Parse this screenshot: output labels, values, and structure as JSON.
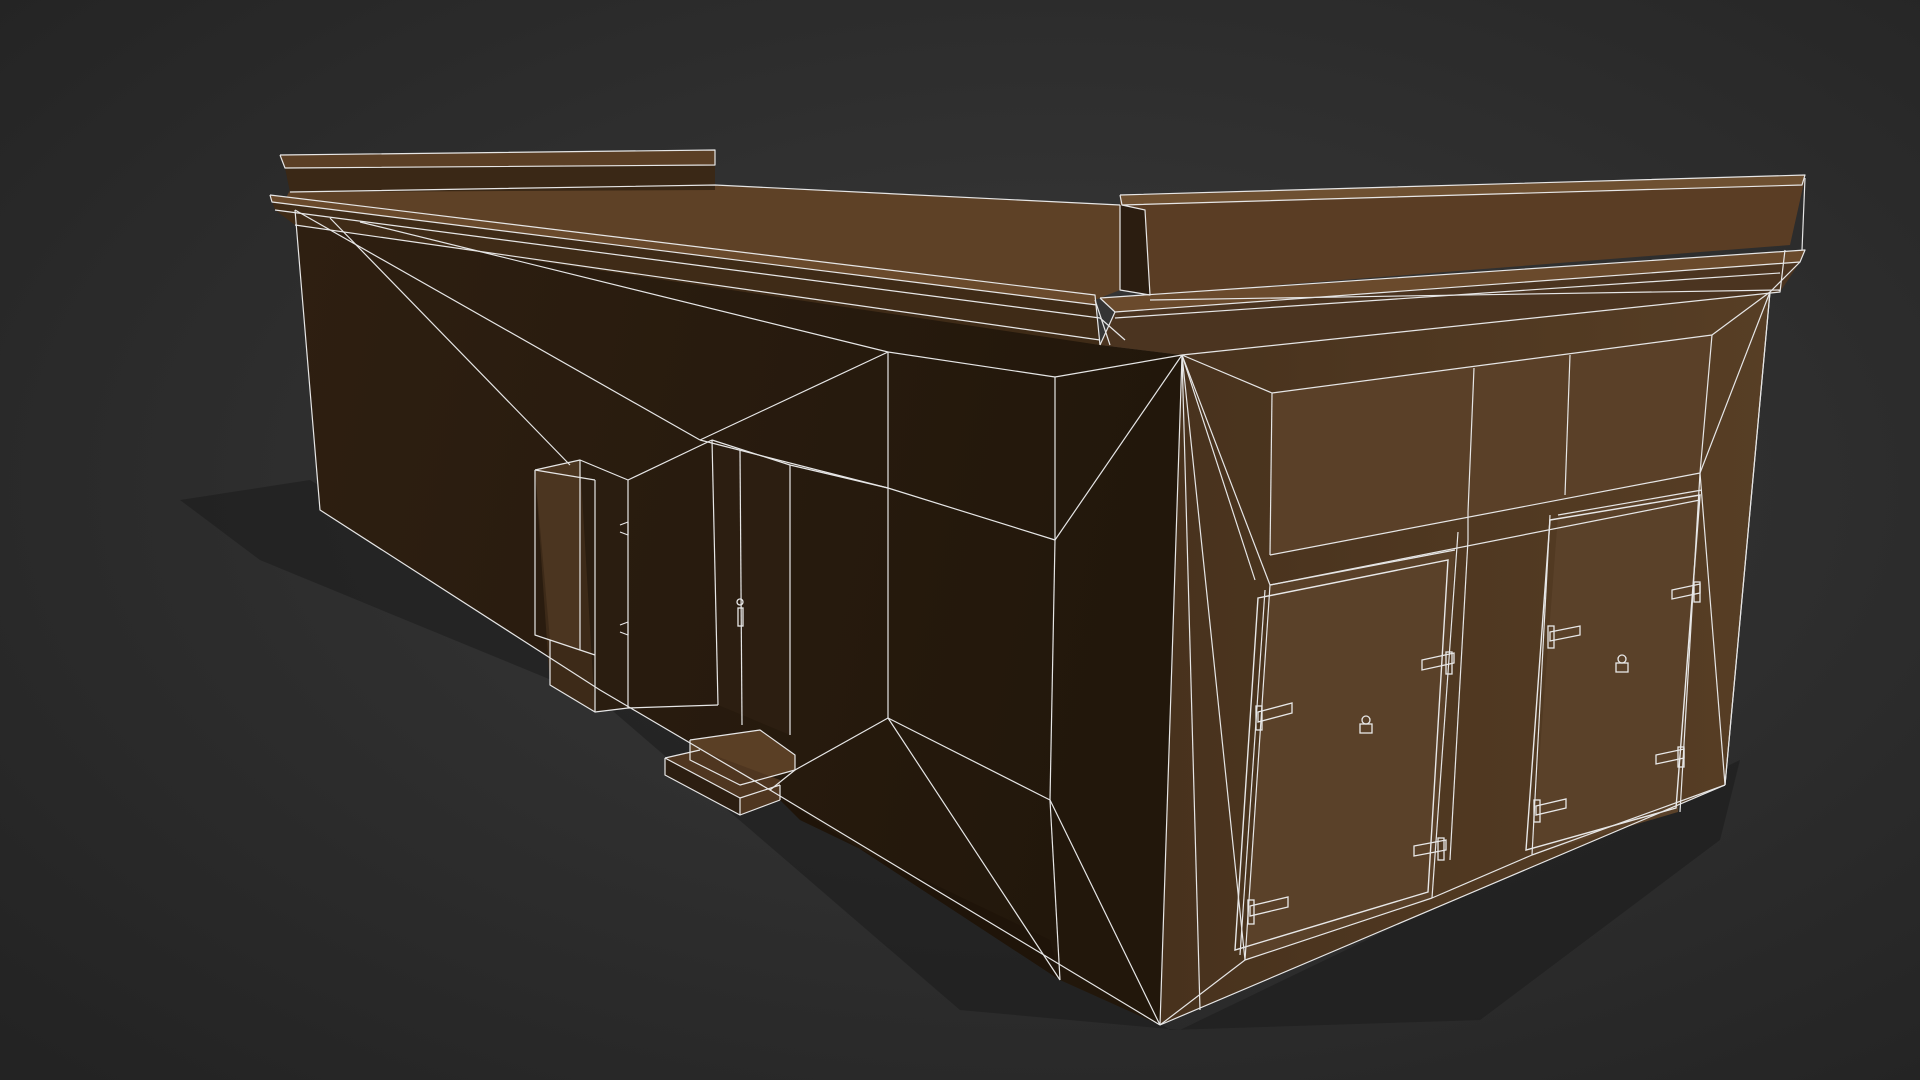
{
  "scene": {
    "subject": "building-model-wireframe",
    "render_style": "shaded-with-wireframe-overlay",
    "colors": {
      "background_center": "#3a3a3a",
      "background_edge": "#232323",
      "wall_front": "#4e3721",
      "wall_side": "#2a1c10",
      "wall_side_dark": "#241809",
      "roof_top": "#5e4126",
      "parapet": "#5a3d24",
      "door": "#57402a",
      "wire": "#e6e6e6",
      "shadow": "#1c1c1c"
    },
    "icons": {
      "door_handle": "handle-icon",
      "hinge": "hinge-icon"
    },
    "parts": {
      "front_doors_count": 2,
      "side_door_count": 1,
      "electrical_box_count": 1,
      "steps_count": 1
    }
  }
}
